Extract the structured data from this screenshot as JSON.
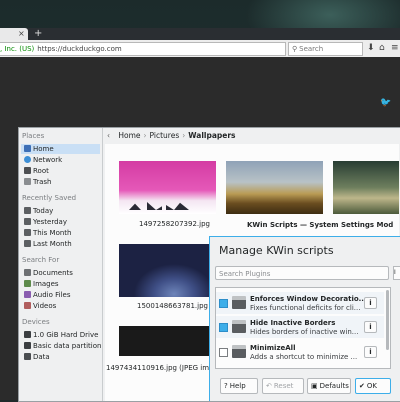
{
  "browser": {
    "tab_close": "×",
    "new_tab": "+",
    "url_identity": ", Inc. (US)",
    "url": "https://duckduckgo.com",
    "reload_icon": "↻",
    "search_placeholder": "Search",
    "download_icon": "⬇",
    "home_icon": "⌂",
    "menu_icon": "≡",
    "twitter_icon": "🐦"
  },
  "places": {
    "sections": {
      "places": "Places",
      "recently_saved": "Recently Saved",
      "search_for": "Search For",
      "devices": "Devices"
    },
    "items": {
      "home": "Home",
      "network": "Network",
      "root": "Root",
      "trash": "Trash",
      "today": "Today",
      "yesterday": "Yesterday",
      "this_month": "This Month",
      "last_month": "Last Month",
      "documents": "Documents",
      "images": "Images",
      "audio_files": "Audio Files",
      "videos": "Videos",
      "hard_drive": "1.0 GiB Hard Drive",
      "basic_data": "Basic data partition",
      "data": "Data"
    }
  },
  "breadcrumb": {
    "back": "‹",
    "home": "Home",
    "sep": "›",
    "pictures": "Pictures",
    "current": "Wallpapers"
  },
  "files": {
    "f1": "1497258207392.jpg",
    "f2": "1500148663781.jpg",
    "f3": "1497434110916.jpg (JPEG imag",
    "overlap_title": "KWin Scripts — System Settings Mod"
  },
  "kwin": {
    "title": "Manage KWin scripts",
    "search_placeholder": "Search Plugins",
    "side_button": "I",
    "scripts": [
      {
        "name": "Enforces Window Decoratio...",
        "desc": "Fixes functional deficits for cli...",
        "enabled": true
      },
      {
        "name": "Hide Inactive Borders",
        "desc": "Hides borders of inactive win...",
        "enabled": true
      },
      {
        "name": "MinimizeAll",
        "desc": "Adds a shortcut to minimize ...",
        "enabled": false
      }
    ],
    "info_glyph": "i",
    "buttons": {
      "help": "Help",
      "help_icon": "?",
      "reset": "Reset",
      "reset_icon": "↶",
      "defaults": "Defaults",
      "defaults_icon": "▣",
      "ok": "OK",
      "ok_icon": "✔",
      "more": "✔"
    }
  },
  "colors": {
    "accent": "#3daee9",
    "selection": "#c9dff5",
    "window_bg": "#eff0f1"
  }
}
